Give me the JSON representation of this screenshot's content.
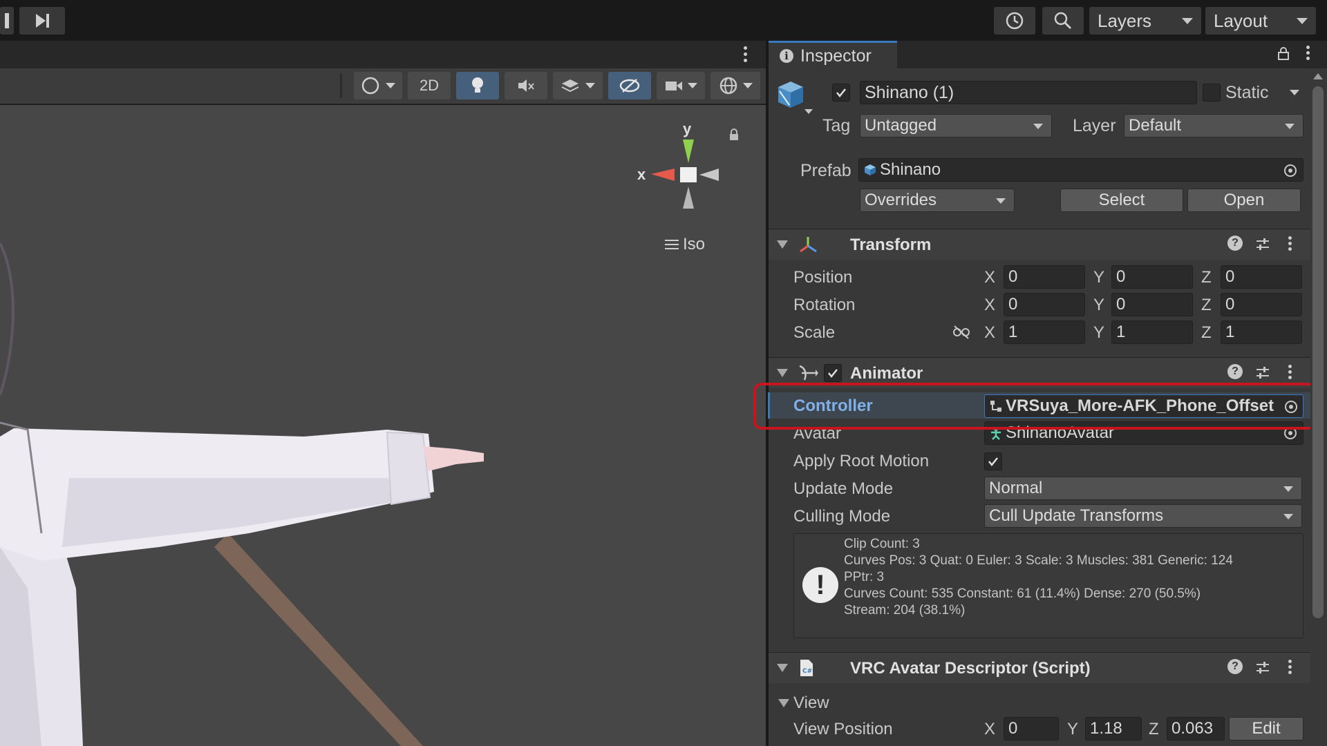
{
  "topbar": {
    "layers_label": "Layers",
    "layout_label": "Layout"
  },
  "scene": {
    "toolbar": {
      "mode_2d_label": "2D"
    },
    "gizmo": {
      "y_label": "y",
      "x_label": "x",
      "projection_label": "Iso"
    }
  },
  "inspector": {
    "tab_label": "Inspector",
    "object": {
      "name": "Shinano (1)",
      "active": true,
      "static_label": "Static",
      "tag_label": "Tag",
      "tag_value": "Untagged",
      "layer_label": "Layer",
      "layer_value": "Default",
      "prefab_label": "Prefab",
      "prefab_value": "Shinano",
      "overrides_label": "Overrides",
      "select_label": "Select",
      "open_label": "Open"
    },
    "transform": {
      "title": "Transform",
      "rows": [
        {
          "label": "Position",
          "x": "0",
          "y": "0",
          "z": "0"
        },
        {
          "label": "Rotation",
          "x": "0",
          "y": "0",
          "z": "0"
        },
        {
          "label": "Scale",
          "x": "1",
          "y": "1",
          "z": "1"
        }
      ],
      "axis_x": "X",
      "axis_y": "Y",
      "axis_z": "Z"
    },
    "animator": {
      "title": "Animator",
      "enabled": true,
      "controller_label": "Controller",
      "controller_value": "VRSuya_More-AFK_Phone_Offset",
      "avatar_label": "Avatar",
      "avatar_value": "ShinanoAvatar",
      "apply_root_motion_label": "Apply Root Motion",
      "update_mode_label": "Update Mode",
      "update_mode_value": "Normal",
      "culling_mode_label": "Culling Mode",
      "culling_mode_value": "Cull Update Transforms",
      "info_lines": [
        "Clip Count: 3",
        "Curves Pos: 3 Quat: 0 Euler: 3 Scale: 3 Muscles: 381 Generic: 124",
        "PPtr: 3",
        "Curves Count: 535 Constant: 61 (11.4%) Dense: 270 (50.5%)",
        "Stream: 204 (38.1%)"
      ]
    },
    "vrc_descriptor": {
      "title": "VRC Avatar Descriptor (Script)",
      "view_label": "View",
      "view_position_label": "View Position",
      "axis_x": "X",
      "axis_y": "Y",
      "axis_z": "Z",
      "x": "0",
      "y": "1.18",
      "z": "0.063",
      "edit_label": "Edit"
    }
  },
  "colors": {
    "highlight_outline": "#c8141e",
    "accent_blue": "#3a79bb",
    "controller_label_color": "#7fb0e8"
  }
}
